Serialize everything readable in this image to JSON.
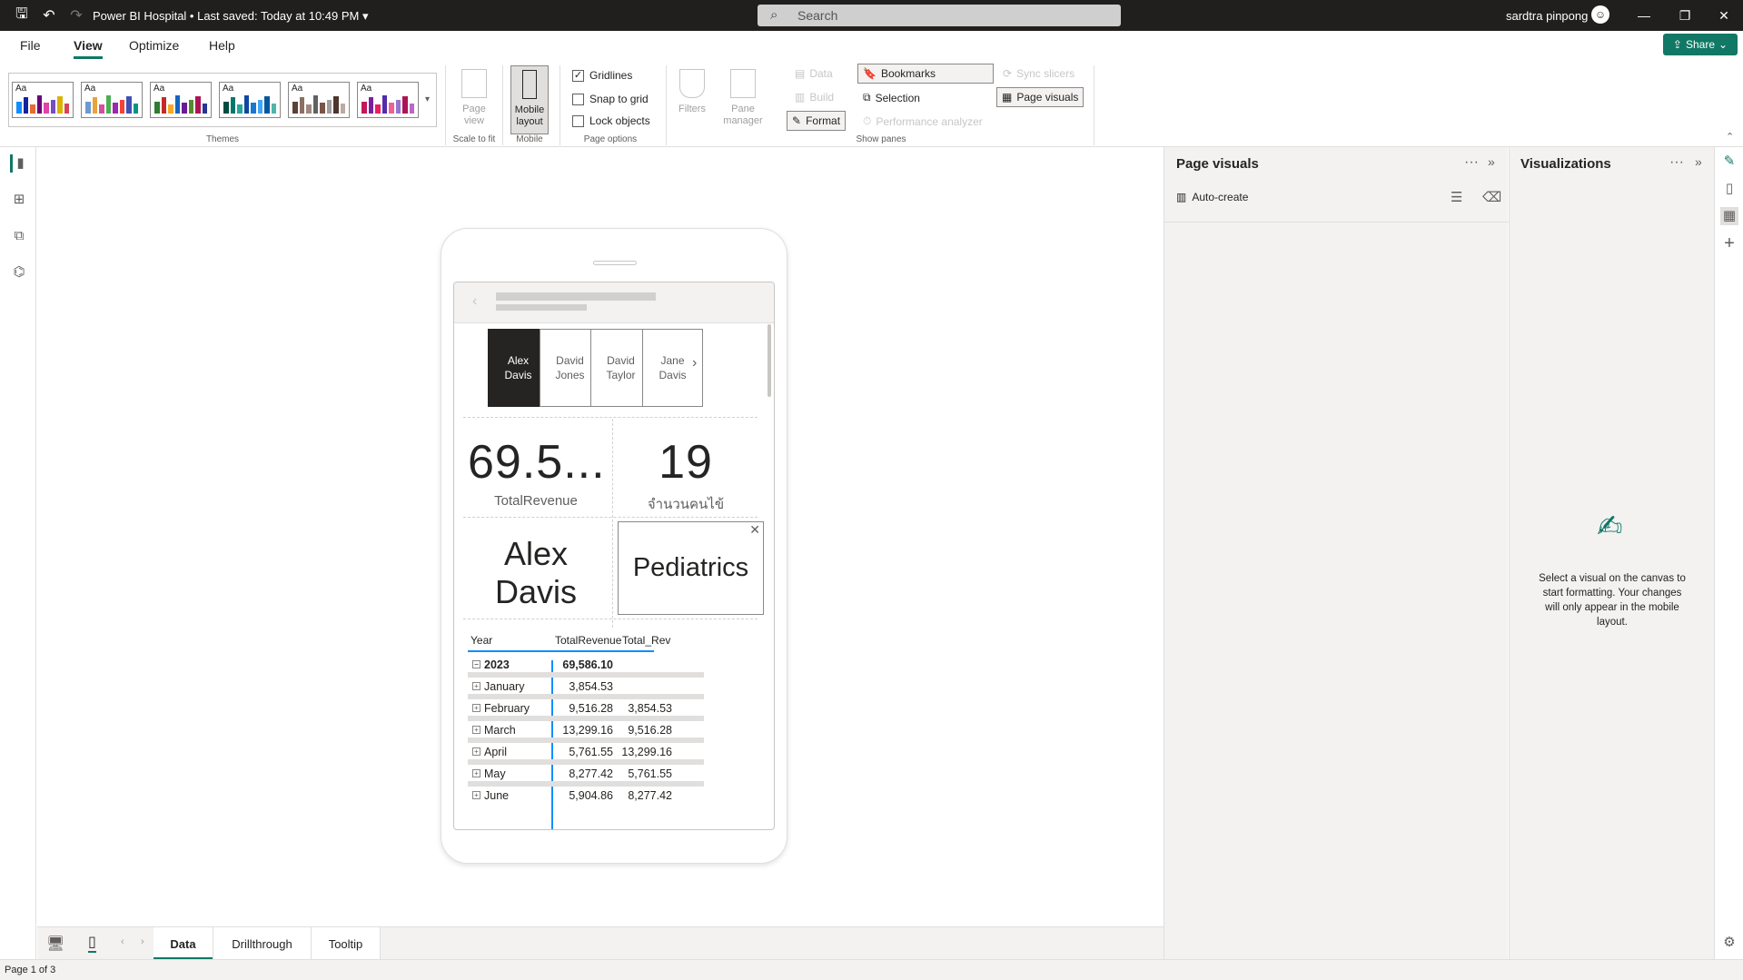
{
  "titlebar": {
    "title": "Power BI Hospital • Last saved: Today at 10:49 PM",
    "search_placeholder": "Search",
    "user_name": "sardtra pinpong"
  },
  "menu": {
    "items": [
      "File",
      "View",
      "Optimize",
      "Help"
    ],
    "active": "View"
  },
  "share_label": "Share",
  "ribbon": {
    "themes_label": "Themes",
    "theme_tile_text": "Aa",
    "page_view_label": "Page view",
    "scale_label": "Scale to fit",
    "mobile_layout_label": "Mobile layout",
    "mobile_label": "Mobile",
    "gridlines_label": "Gridlines",
    "snap_label": "Snap to grid",
    "lock_label": "Lock objects",
    "page_options_label": "Page options",
    "filters_label": "Filters",
    "pane_manager_label": "Pane manager",
    "data_label": "Data",
    "build_label": "Build",
    "format_label": "Format",
    "bookmarks_label": "Bookmarks",
    "selection_label": "Selection",
    "perf_label": "Performance analyzer",
    "sync_label": "Sync slicers",
    "page_visuals_label": "Page visuals",
    "show_panes_label": "Show panes"
  },
  "slicer": {
    "items": [
      [
        "Alex",
        "Davis"
      ],
      [
        "David",
        "Jones"
      ],
      [
        "David",
        "Taylor"
      ],
      [
        "Jane",
        "Davis"
      ]
    ],
    "selected": 0
  },
  "cards": {
    "revenue_value": "69.5...",
    "revenue_label": "TotalRevenue",
    "patients_value": "19",
    "patients_label": "จำนวนคนไข้",
    "doctor_line1": "Alex",
    "doctor_line2": "Davis",
    "department": "Pediatrics"
  },
  "table": {
    "headers": [
      "Year",
      "TotalRevenue",
      "Total_Rev"
    ],
    "year_row": {
      "label": "2023",
      "revenue": "69,586.10",
      "prev": ""
    },
    "rows": [
      {
        "label": "January",
        "revenue": "3,854.53",
        "prev": ""
      },
      {
        "label": "February",
        "revenue": "9,516.28",
        "prev": "3,854.53"
      },
      {
        "label": "March",
        "revenue": "13,299.16",
        "prev": "9,516.28"
      },
      {
        "label": "April",
        "revenue": "5,761.55",
        "prev": "13,299.16"
      },
      {
        "label": "May",
        "revenue": "8,277.42",
        "prev": "5,761.55"
      },
      {
        "label": "June",
        "revenue": "5,904.86",
        "prev": "8,277.42"
      }
    ]
  },
  "page_tabs": {
    "items": [
      "Data",
      "Drillthrough",
      "Tooltip"
    ],
    "active": "Data"
  },
  "status_text": "Page 1 of 3",
  "page_visuals_pane": {
    "title": "Page visuals",
    "auto_create_label": "Auto-create"
  },
  "viz_pane": {
    "title": "Visualizations",
    "message": "Select a visual on the canvas to start formatting. Your changes will only appear in the mobile layout."
  },
  "colors": {
    "accent": "#117865",
    "selection": "#118dff",
    "titlebar": "#201f1e"
  },
  "icons": [
    "save-icon",
    "undo-icon",
    "redo-icon",
    "search-icon",
    "avatar-icon",
    "minimize-icon",
    "restore-icon",
    "close-icon"
  ]
}
